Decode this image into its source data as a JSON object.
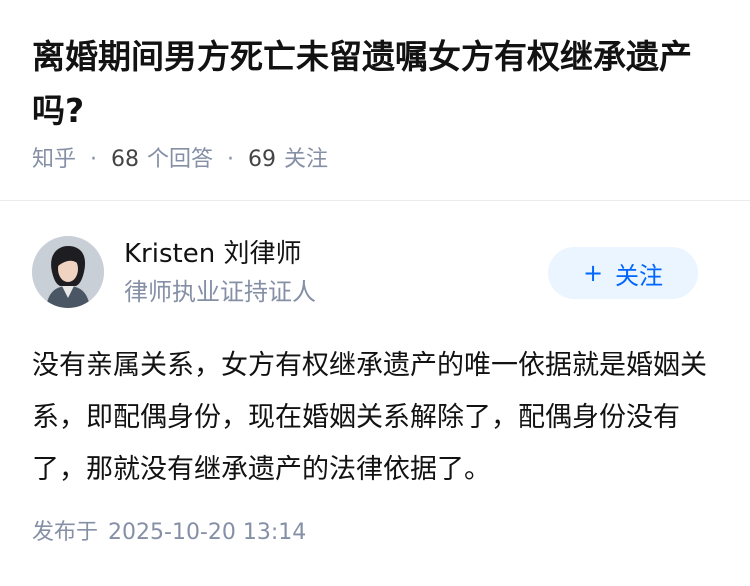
{
  "question": {
    "title": "离婚期间男方死亡未留遗嘱女方有权继承遗产吗?",
    "source": "知乎",
    "answer_count": "68",
    "answer_label": "个回答",
    "follower_count": "69",
    "follower_label": "关注"
  },
  "author": {
    "name": "Kristen 刘律师",
    "headline": "律师执业证持证人",
    "follow_icon": "+",
    "follow_label": "关注",
    "accent_color": "#0066ff"
  },
  "answer": {
    "content": "没有亲属关系，女方有权继承遗产的唯一依据就是婚姻关系，即配偶身份，现在婚姻关系解除了，配偶身份没有了，那就没有继承遗产的法律依据了。",
    "publish_label": "发布于",
    "publish_time": "2025-10-20 13:14"
  }
}
